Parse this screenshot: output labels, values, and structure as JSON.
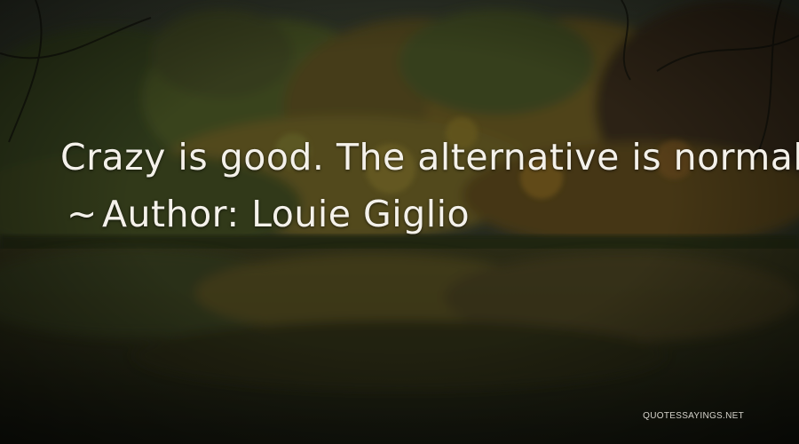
{
  "quote": {
    "text": "Crazy is good. The alternative is normal."
  },
  "author": {
    "dash": "~",
    "label": "Author: Louie Giglio"
  },
  "watermark": {
    "text": "QUOTESSAYINGS.NET"
  },
  "colors": {
    "text": "#f4f1ea",
    "background_dark": "#1a1f14",
    "foliage_autumn": "#6b5a22",
    "foliage_green": "#3d4a22"
  }
}
